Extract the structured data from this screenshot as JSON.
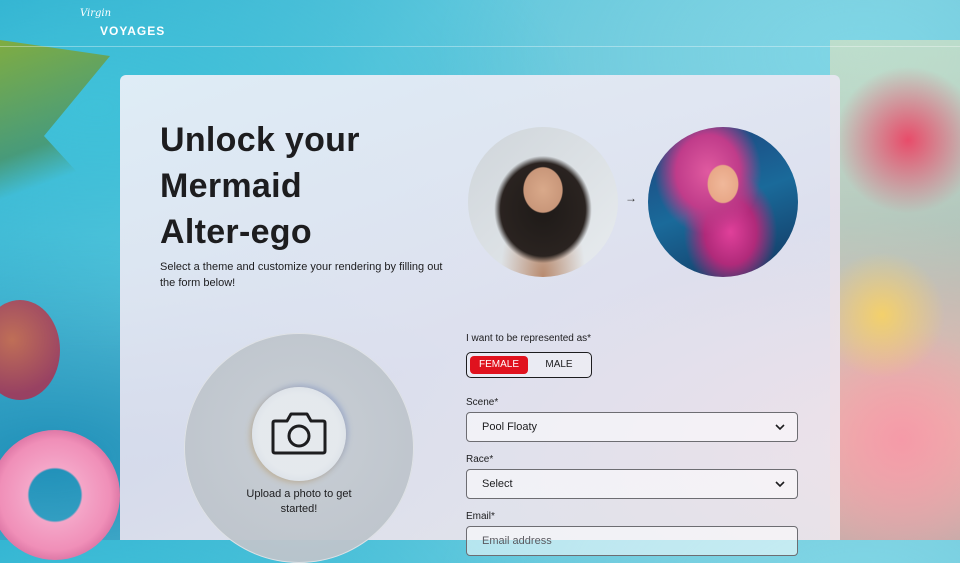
{
  "brand": {
    "script": "Virgin",
    "word": "VOYAGES"
  },
  "hero": {
    "title_lines": [
      "Unlock your",
      "Mermaid",
      "Alter-ego"
    ],
    "subtitle": "Select a theme and customize your rendering by filling out the form below!",
    "arrow": "→"
  },
  "upload": {
    "text": "Upload a photo to get started!"
  },
  "form": {
    "represented_label": "I want to be represented as*",
    "options": [
      "FEMALE",
      "MALE"
    ],
    "selected_option": "FEMALE",
    "scene_label": "Scene*",
    "scene_value": "Pool Floaty",
    "race_label": "Race*",
    "race_value": "Select",
    "email_label": "Email*",
    "email_placeholder": "Email address"
  },
  "colors": {
    "accent": "#e0121e",
    "text": "#1d1d1f"
  },
  "icons": {
    "camera": "camera-icon",
    "chevron": "chevron-down-icon"
  }
}
